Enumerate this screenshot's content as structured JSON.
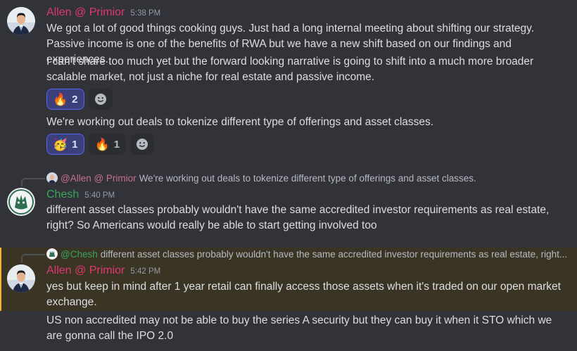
{
  "colors": {
    "allen_name": "#e0386c",
    "chesh_name": "#3ba55c",
    "highlight_bg": "#3a3425",
    "accent": "#5865f2"
  },
  "messages": [
    {
      "author": "Allen @ Primior",
      "time": "5:38 PM",
      "lines": [
        "We got a lot of good things cooking guys. Just had a long internal meeting about shifting our strategy. Passive income is one of the benefits of RWA but we have a new shift based on our findings and experiences.",
        "I can't share too much yet but the forward looking narrative is going to shift into a much more broader scalable market, not just a niche for real estate and passive income.",
        "We're working out deals to tokenize different type of offerings and asset classes."
      ],
      "reactions1": [
        {
          "emoji": "🔥",
          "count": "2",
          "icon": "fire-icon"
        }
      ],
      "reactions2": [
        {
          "emoji": "🥳",
          "count": "1",
          "icon": "party-face-icon"
        },
        {
          "emoji": "🔥",
          "count": "1",
          "icon": "fire-icon"
        }
      ]
    },
    {
      "reply_to": "@Allen @ Primior",
      "reply_text": "We're working out deals to tokenize different type of offerings and asset classes.",
      "author": "Chesh",
      "time": "5:40 PM",
      "text": "different asset classes probably wouldn't have the same accredited investor requirements as real estate, right? So Americans would really be able to start getting involved too"
    },
    {
      "reply_to": "@Chesh",
      "reply_text": "different asset classes probably wouldn't have the same accredited investor requirements as real estate, right...",
      "author": "Allen @ Primior",
      "time": "5:42 PM",
      "lines": [
        "yes but keep in mind after 1 year retail can finally access those assets when it's traded on our open market exchange.",
        "US non accredited may not be able to buy the series A security but they can buy it when it STO which we are gonna call the IPO 2.0"
      ]
    }
  ]
}
